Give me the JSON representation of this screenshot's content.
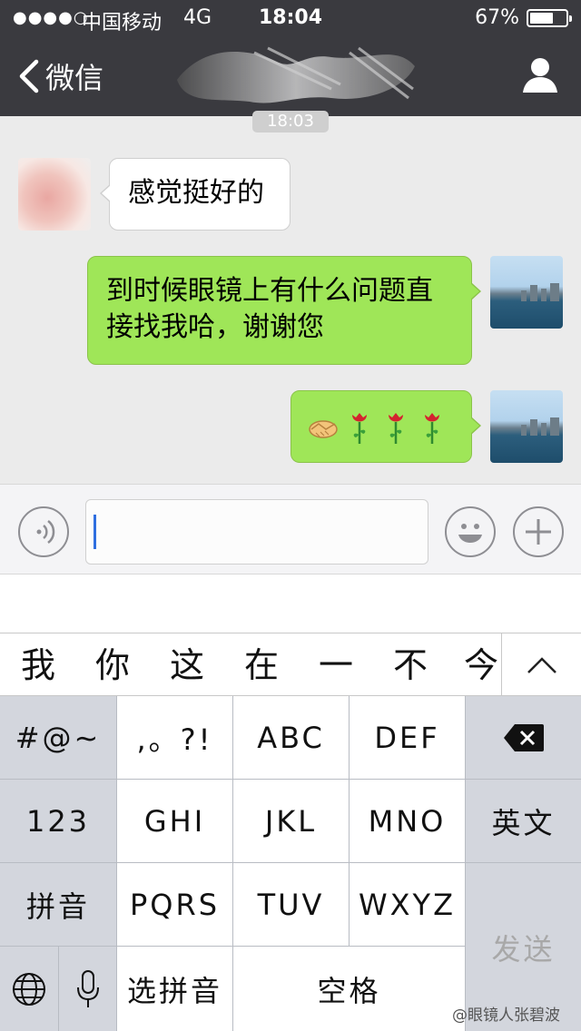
{
  "status_bar": {
    "signal": "●●●●○",
    "carrier": "中国移动",
    "network": "4G",
    "time": "18:04",
    "battery_percent": "67%",
    "battery_level": 0.67
  },
  "nav": {
    "back_label": "微信"
  },
  "chat": {
    "timestamp": "18:03",
    "messages": [
      {
        "side": "incoming",
        "text": "感觉挺好的"
      },
      {
        "side": "outgoing",
        "text": "到时候眼镜上有什么问题直接找我哈，谢谢您"
      },
      {
        "side": "outgoing",
        "emojis": [
          "handshake",
          "rose",
          "rose",
          "rose"
        ]
      }
    ]
  },
  "input": {
    "value": ""
  },
  "candidates": [
    "我",
    "你",
    "这",
    "在",
    "一",
    "不",
    "今"
  ],
  "keyboard": {
    "rows": [
      [
        "#@~",
        ",。?!",
        "ABC",
        "DEF",
        "delete"
      ],
      [
        "123",
        "GHI",
        "JKL",
        "MNO",
        "英文"
      ],
      [
        "拼音",
        "PQRS",
        "TUV",
        "WXYZ",
        "发送"
      ],
      [
        "globe",
        "mic",
        "选拼音",
        "空格"
      ]
    ],
    "k_symbols": "#@~",
    "k_punct": ",。?!",
    "k_abc": "ABC",
    "k_def": "DEF",
    "k_123": "123",
    "k_ghi": "GHI",
    "k_jkl": "JKL",
    "k_mno": "MNO",
    "k_english": "英文",
    "k_pinyin": "拼音",
    "k_pqrs": "PQRS",
    "k_tuv": "TUV",
    "k_wxyz": "WXYZ",
    "k_send": "发送",
    "k_select_pinyin": "选拼音",
    "k_space": "空格"
  },
  "watermark": "@眼镜人张碧波",
  "colors": {
    "nav_bg": "#3a3a3f",
    "chat_bg": "#ebebeb",
    "outgoing_bubble": "#9fe658",
    "incoming_bubble": "#ffffff",
    "caret": "#2f6fe0"
  }
}
